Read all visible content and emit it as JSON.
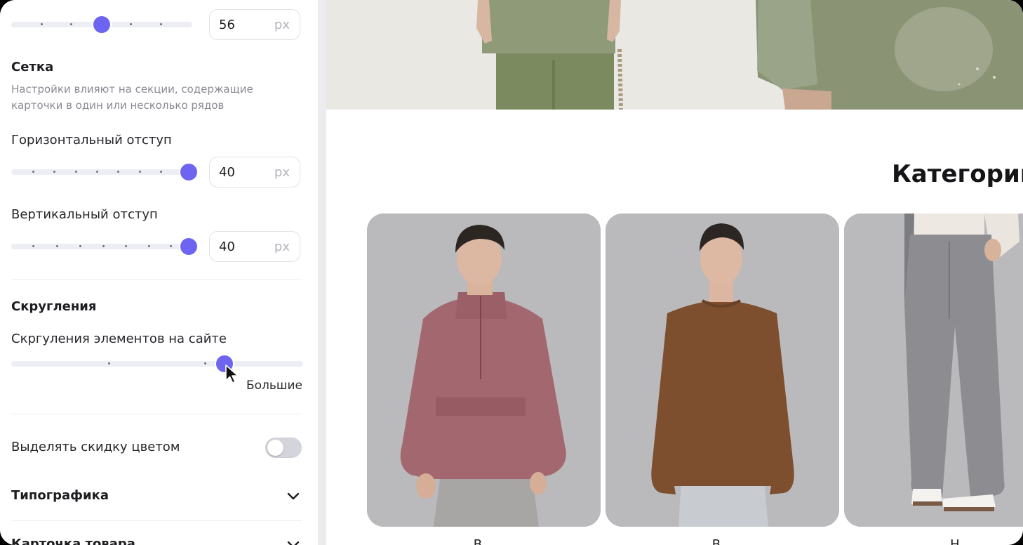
{
  "settings": {
    "top_slider": {
      "value": "56",
      "unit": "px",
      "level": 0.5
    },
    "grid": {
      "title": "Сетка",
      "hint": "Настройки влияют на секции, содержащие карточки в один или несколько рядов",
      "horizontal": {
        "label": "Горизонтальный отступ",
        "value": "40",
        "unit": "px",
        "level": 1.0
      },
      "vertical": {
        "label": "Вертикальный отступ",
        "value": "40",
        "unit": "px",
        "level": 1.0
      }
    },
    "rounding": {
      "title": "Скругления",
      "label": "Скргуления элементов на сайте",
      "caption": "Большие",
      "level": 0.75
    },
    "discount_toggle": {
      "label": "Выделять скидку цветом",
      "on": false
    },
    "typography": {
      "label": "Типографика"
    },
    "product_card": {
      "label": "Карточка товара"
    }
  },
  "preview": {
    "heading": "Категории",
    "cards": [
      {
        "caption": "В..."
      },
      {
        "caption": "В..."
      },
      {
        "caption": "Н..."
      }
    ]
  },
  "colors": {
    "accent": "#6d64f2",
    "jacket": "#a3676f",
    "sweater": "#7d4f2e",
    "trousers": "#8d8d91",
    "card_bg": "#b9b9bb"
  }
}
